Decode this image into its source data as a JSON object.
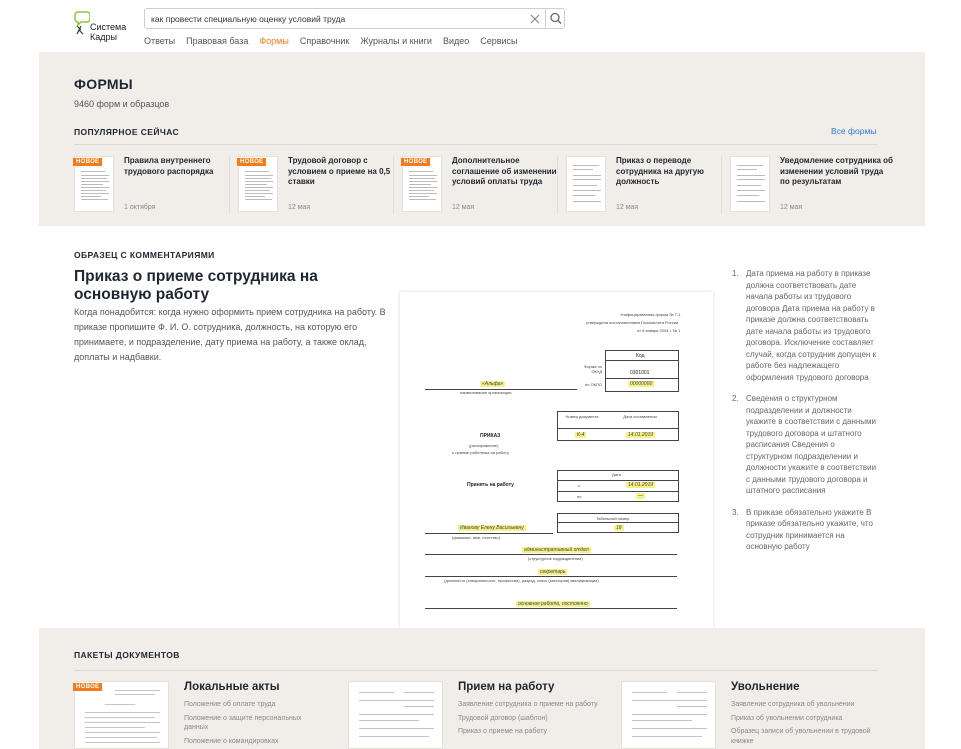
{
  "header": {
    "logo_line1": "Система",
    "logo_line2": "Кадры",
    "search_value": "как провести специальную оценку условий труда",
    "nav": [
      {
        "label": "Ответы",
        "active": false
      },
      {
        "label": "Правовая база",
        "active": false
      },
      {
        "label": "Формы",
        "active": true
      },
      {
        "label": "Справочник",
        "active": false
      },
      {
        "label": "Журналы и книги",
        "active": false
      },
      {
        "label": "Видео",
        "active": false
      },
      {
        "label": "Сервисы",
        "active": false
      }
    ]
  },
  "forms": {
    "title": "ФОРМЫ",
    "count": "9460 форм и образцов",
    "popular_label": "ПОПУЛЯРНОЕ СЕЙЧАС",
    "all_forms": "Все формы",
    "cards": [
      {
        "badge": "НОВОЕ",
        "title": "Правила внутреннего трудового распорядка",
        "date": "1 октября"
      },
      {
        "badge": "НОВОЕ",
        "title": "Трудовой договор с условием о приеме на 0,5 ставки",
        "date": "12 мая"
      },
      {
        "badge": "НОВОЕ",
        "title": "Дополнительное соглашение об изменении условий оплаты труда",
        "date": "12 мая"
      },
      {
        "badge": "",
        "title": "Приказ о переводе сотрудника на другую должность",
        "date": "12 мая"
      },
      {
        "badge": "",
        "title": "Уведомление сотрудника об изменении условий труда по результатам",
        "date": "12 мая"
      }
    ]
  },
  "sample": {
    "label": "ОБРАЗЕЦ С КОММЕНТАРИЯМИ",
    "title": "Приказ о приеме сотрудника на основную работу",
    "description": "Когда понадобится: когда нужно оформить прием сотрудника на работу. В приказе пропишите Ф. И. О. сотрудника, должность, на которую его принимаете, и подразделение, дату приема на работу, а также оклад, доплаты и надбавки.",
    "notes": [
      {
        "num": "1.",
        "text": "Дата приема на работу в приказе должна соответствовать дате начала работы из трудового договора Дата приема на работу в приказе должна соответствовать дате начала работы из трудового договора. Исключение составляет случай, когда сотрудник допущен к работе без надлежащего оформления трудового договора"
      },
      {
        "num": "2.",
        "text": "Сведения о структурном подразделении и должности укажите в соответствии с данными трудового договора и штатного расписания Сведения о структурном подразделении и должности укажите в соответствии с данными трудового договора и штатного расписания"
      },
      {
        "num": "3.",
        "text": "В приказе обязательно укажите В приказе обязательно укажите, что сотрудник принимается на основную работу"
      }
    ],
    "doc": {
      "header_line1": "Унифицированная форма № Т-1",
      "header_line2": "утверждена постановлением Госкомстата России",
      "header_line3": "от 5 января 2004 г. № 1",
      "code_label": "Код",
      "okud_label": "Форма по ОКУД",
      "okud_value": "0301001",
      "okpo_label": "по ОКПО",
      "okpo_value": "00000000",
      "org_name": "«Альфа»",
      "org_caption": "наименование организации",
      "doc_number_label": "Номер документа",
      "doc_date_label": "Дата составления",
      "doc_number": "К-4",
      "doc_date": "14.01.2019",
      "order_title": "ПРИКАЗ",
      "order_sub": "(распоряжение)",
      "order_about": "о приеме работника на работу",
      "date_label": "Дата",
      "hire_label": "Принять на работу",
      "from_label": "с",
      "from_value": "14.01.2019",
      "to_label": "по",
      "to_value": "—",
      "tab_label": "Табельный номер",
      "employee": "Иванову Елену Васильевну",
      "employee_caption": "(фамилия, имя, отчество)",
      "tab_value": "18",
      "dept": "административный отдел",
      "dept_caption": "(структурное подразделение)",
      "position": "секретарь",
      "position_caption": "(должность (специальность, профессия), разряд, класс (категория) квалификации)",
      "work_type": "основная работа, постоянно"
    }
  },
  "packets": {
    "label": "ПАКЕТЫ ДОКУМЕНТОВ",
    "items": [
      {
        "badge": "НОВОЕ",
        "title": "Локальные акты",
        "docs": [
          "Положение об оплате труда",
          "Положение о защите персональных данных",
          "Положение о командировках"
        ]
      },
      {
        "badge": "",
        "title": "Прием на работу",
        "docs": [
          "Заявление сотрудника о приеме на работу",
          "Трудовой договор (шаблон)",
          "Приказ о приеме на работу"
        ]
      },
      {
        "badge": "",
        "title": "Увольнение",
        "docs": [
          "Заявление сотрудника об увольнении",
          "Приказ об увольнении сотрудника",
          "Образец записи об увольнении в трудовой книжке"
        ]
      }
    ]
  },
  "colors": {
    "accent": "#f27c1b",
    "link": "#2e7bd6",
    "section_bg": "#f1eeea",
    "highlight": "#f4f08a"
  }
}
